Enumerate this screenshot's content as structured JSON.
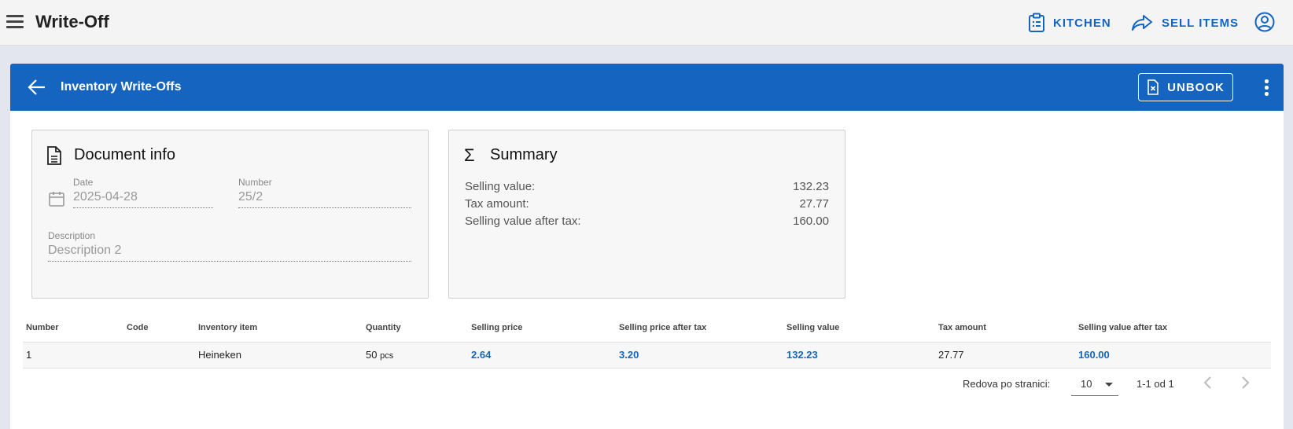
{
  "app": {
    "title": "Write-Off"
  },
  "topbar": {
    "kitchen_label": "KITCHEN",
    "sell_items_label": "SELL ITEMS"
  },
  "colors": {
    "accent": "#1565c0",
    "appbar_bg": "#f4f4f4",
    "page_bg": "#e3e6ee"
  },
  "header": {
    "title": "Inventory Write-Offs",
    "unbook_label": "UNBOOK"
  },
  "document_info": {
    "title": "Document info",
    "date_label": "Date",
    "date_value": "2025-04-28",
    "number_label": "Number",
    "number_value": "25/2",
    "description_label": "Description",
    "description_value": "Description 2"
  },
  "summary": {
    "title": "Summary",
    "rows": [
      {
        "label": "Selling value:",
        "value": "132.23"
      },
      {
        "label": "Tax amount:",
        "value": "27.77"
      },
      {
        "label": "Selling value after tax:",
        "value": "160.00"
      }
    ]
  },
  "table": {
    "columns": [
      "Number",
      "Code",
      "Inventory item",
      "Quantity",
      "Selling price",
      "Selling price after tax",
      "Selling value",
      "Tax amount",
      "Selling value after tax"
    ],
    "rows": [
      {
        "number": "1",
        "code": "",
        "item": "Heineken",
        "quantity": "50",
        "unit": "pcs",
        "selling_price": "2.64",
        "selling_price_after_tax": "3.20",
        "selling_value": "132.23",
        "tax_amount": "27.77",
        "selling_value_after_tax": "160.00"
      }
    ]
  },
  "pagination": {
    "rows_per_page_label": "Redova po stranici:",
    "rows_per_page": "10",
    "range": "1-1 od 1"
  }
}
